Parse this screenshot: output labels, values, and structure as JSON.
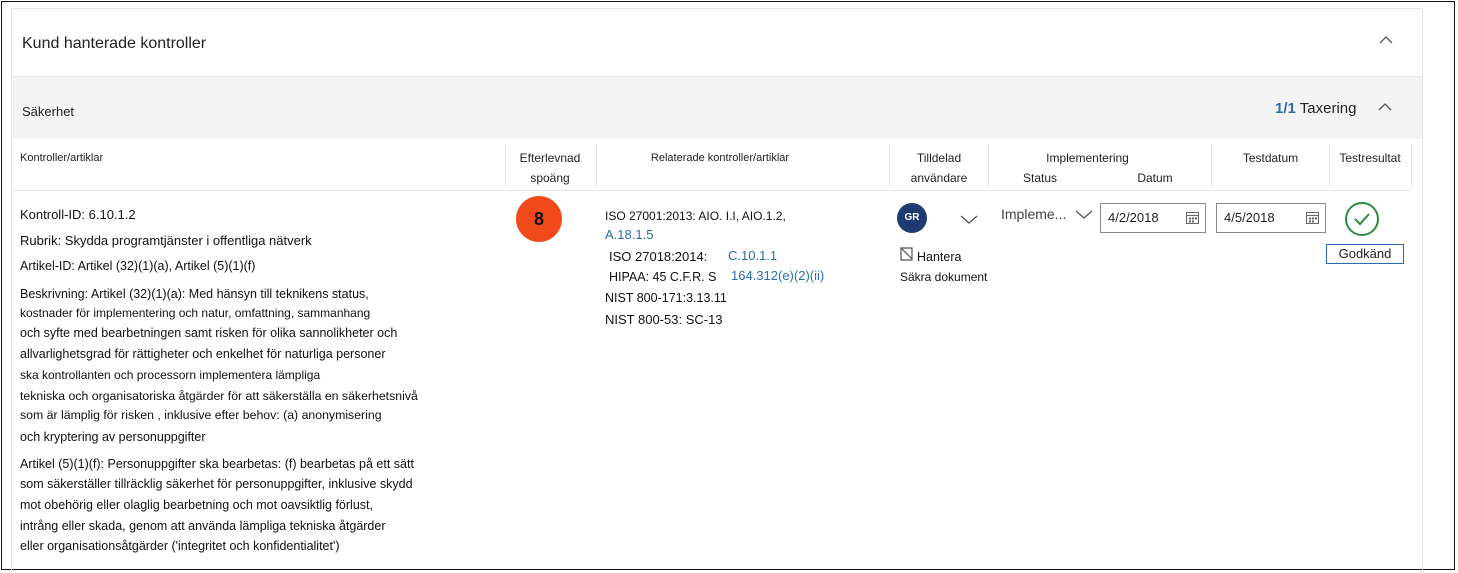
{
  "header": {
    "title": "Kund hanterade kontroller"
  },
  "section": {
    "title": "Säkerhet",
    "count_strong": "1/1",
    "count_label": "Taxering"
  },
  "columns": {
    "controls": "Kontroller/artiklar",
    "score_line1": "Efterlevnad",
    "score_line2": "spoäng",
    "related": "Relaterade kontroller/artiklar",
    "assigned_line1": "Tilldelad",
    "assigned_line2": "användare",
    "implementation": "Implementering",
    "impl_status": "Status",
    "impl_date": "Datum",
    "test_date": "Testdatum",
    "test_result": "Testresultat"
  },
  "row": {
    "control_id": "Kontroll-ID: 6.10.1.2",
    "rubric": "Rubrik: Skydda programtjänster i offentliga nätverk",
    "article_id": "Artikel-ID: Artikel (32)(1)(a), Artikel (5)(1)(f)",
    "description_lines": [
      "Beskrivning: Artikel (32)(1)(a): Med hänsyn till teknikens status,",
      "kostnader för implementering och natur, omfattning, sammanhang",
      "och syfte med bearbetningen samt risken för olika sannolikheter och",
      "allvarlighetsgrad för rättigheter och enkelhet för naturliga personer",
      "ska kontrollanten och processorn implementera lämpliga",
      "tekniska och organisatoriska åtgärder för att säkerställa en säkerhetsnivå",
      "som är lämplig för risken , inklusive efter behov: (a) anonymisering",
      "och kryptering av personuppgifter"
    ],
    "article2_lines": [
      "Artikel (5)(1)(f): Personuppgifter ska bearbetas: (f) bearbetas på ett sätt",
      "som säkerställer tillräcklig säkerhet för personuppgifter, inklusive skydd",
      "mot obehörig eller olaglig bearbetning och mot oavsiktlig förlust,",
      "intrång eller skada, genom att använda lämpliga tekniska åtgärder",
      "eller organisationsåtgärder ('integritet och konfidentialitet')"
    ],
    "score": "8",
    "related": {
      "iso27001_prefix": "ISO 27001:2013: AIO. I.I, AIO.1.2,",
      "iso27001_link": "A.18.1.5",
      "iso27018_prefix": "ISO 27018:2014:",
      "iso27018_link": "C.10.1.1",
      "hipaa_prefix": "HIPAA: 45 C.F.R. S",
      "hipaa_link": "164.312(e)(2)(ii)",
      "nist171": "NIST 800-171:3.13.11",
      "nist53": "NIST 800-53: SC-13"
    },
    "assigned": {
      "initials": "GR",
      "manage_label": "Hantera",
      "docs_label": "Säkra dokument"
    },
    "implementation_status": "Impleme...",
    "implementation_date": "4/2/2018",
    "test_date": "4/5/2018",
    "test_result": "Godkänd"
  },
  "icons": {
    "collapse": "chevron-up-icon",
    "dropdown": "chevron-down-icon",
    "calendar": "calendar-icon",
    "manage": "document-icon",
    "result": "checkmark-icon"
  },
  "colors": {
    "score": "#f04a1a",
    "avatar": "#1f3a70",
    "link": "#2b6cb0",
    "pass": "#2e8b3e"
  }
}
